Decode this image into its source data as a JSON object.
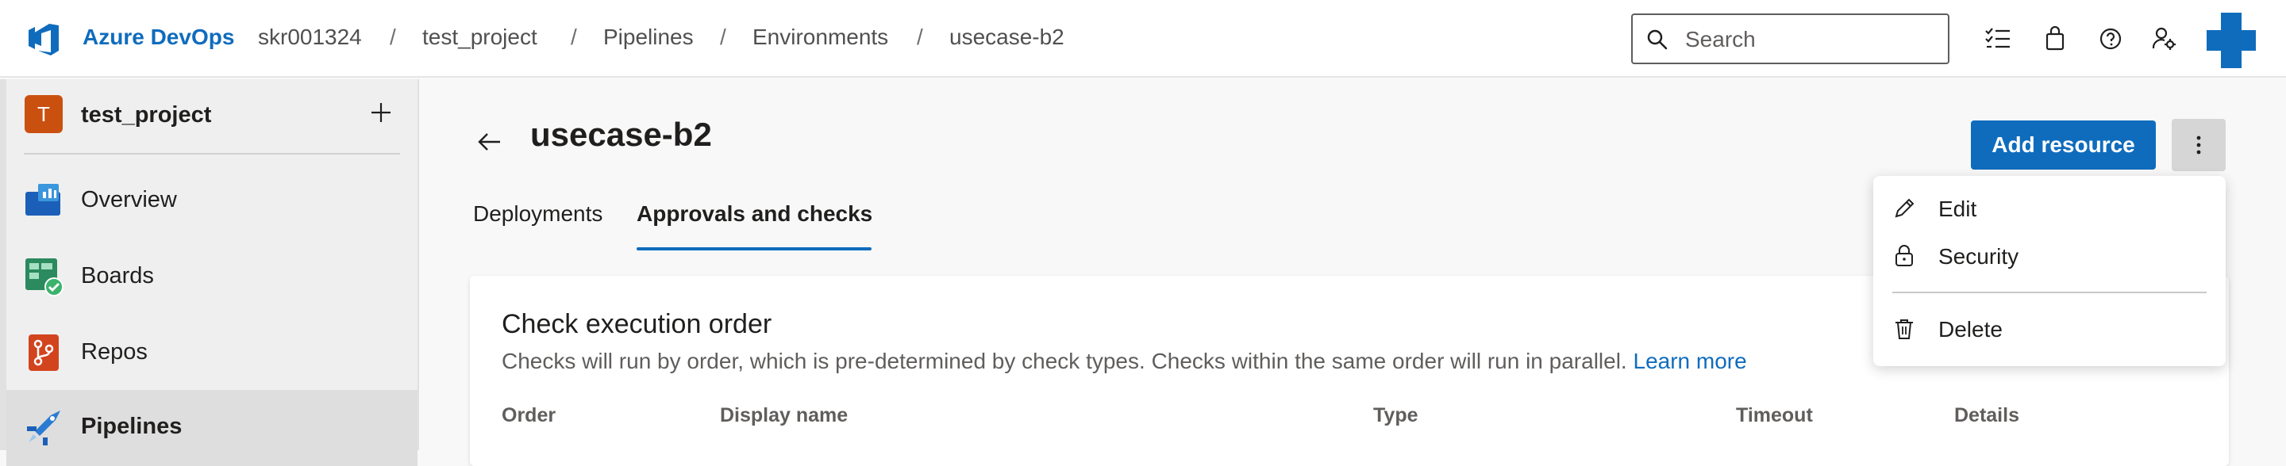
{
  "header": {
    "brand": "Azure DevOps",
    "breadcrumbs": [
      "skr001324",
      "test_project",
      "Pipelines",
      "Environments",
      "usecase-b2"
    ],
    "separator": "/",
    "search_placeholder": "Search",
    "icons": [
      "task-list-icon",
      "shopping-bag-icon",
      "help-icon",
      "user-settings-icon",
      "user-avatar-icon"
    ]
  },
  "sidebar": {
    "project_initial": "T",
    "project_name": "test_project",
    "items": [
      {
        "label": "Overview",
        "icon": "overview-icon"
      },
      {
        "label": "Boards",
        "icon": "boards-icon"
      },
      {
        "label": "Repos",
        "icon": "repos-icon"
      },
      {
        "label": "Pipelines",
        "icon": "pipelines-icon",
        "active": true
      }
    ]
  },
  "main": {
    "title": "usecase-b2",
    "add_resource_label": "Add resource",
    "tabs": [
      {
        "label": "Deployments",
        "active": false
      },
      {
        "label": "Approvals and checks",
        "active": true
      }
    ],
    "card": {
      "title": "Check execution order",
      "description": "Checks will run by order, which is pre-determined by check types. Checks within the same order will run in parallel.",
      "learn_more": "Learn more",
      "columns": [
        "Order",
        "Display name",
        "Type",
        "Timeout",
        "Details"
      ]
    }
  },
  "menu": {
    "items": [
      {
        "label": "Edit",
        "icon": "pencil-icon"
      },
      {
        "label": "Security",
        "icon": "lock-icon"
      },
      {
        "label": "Delete",
        "icon": "trash-icon"
      }
    ]
  },
  "colors": {
    "accent": "#0f6cbd",
    "project_avatar": "#ca5010"
  }
}
